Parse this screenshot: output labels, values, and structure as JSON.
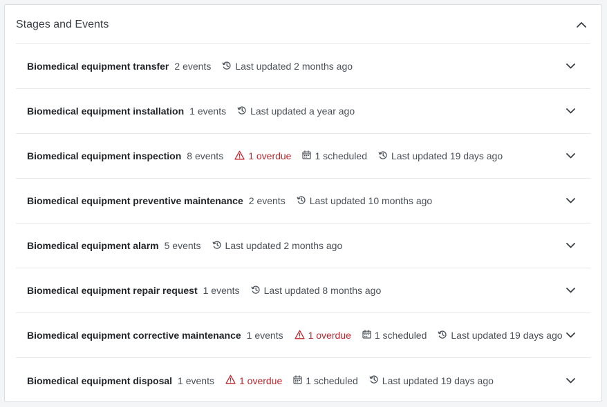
{
  "panel": {
    "title": "Stages and Events",
    "collapse_icon": "chevron-up-icon"
  },
  "stages": [
    {
      "name": "Biomedical equipment transfer",
      "events": "2 events",
      "updated": "Last updated 2 months ago"
    },
    {
      "name": "Biomedical equipment installation",
      "events": "1 events",
      "updated": "Last updated a year ago"
    },
    {
      "name": "Biomedical equipment inspection",
      "events": "8 events",
      "overdue": "1 overdue",
      "scheduled": "1 scheduled",
      "updated": "Last updated 19 days ago"
    },
    {
      "name": "Biomedical equipment preventive maintenance",
      "events": "2 events",
      "updated": "Last updated 10 months ago"
    },
    {
      "name": "Biomedical equipment alarm",
      "events": "5 events",
      "updated": "Last updated 2 months ago"
    },
    {
      "name": "Biomedical equipment repair request",
      "events": "1 events",
      "updated": "Last updated 8 months ago"
    },
    {
      "name": "Biomedical equipment corrective maintenance",
      "events": "1 events",
      "overdue": "1 overdue",
      "scheduled": "1 scheduled",
      "updated": "Last updated 19 days ago"
    },
    {
      "name": "Biomedical equipment disposal",
      "events": "1 events",
      "overdue": "1 overdue",
      "scheduled": "1 scheduled",
      "updated": "Last updated 19 days ago"
    }
  ],
  "colors": {
    "overdue": "#c0262d",
    "text_muted": "#4a5058",
    "border": "#e6e8eb"
  },
  "icons": {
    "history": "history-icon",
    "warning": "warning-icon",
    "calendar": "calendar-icon",
    "expand": "chevron-down-icon"
  }
}
